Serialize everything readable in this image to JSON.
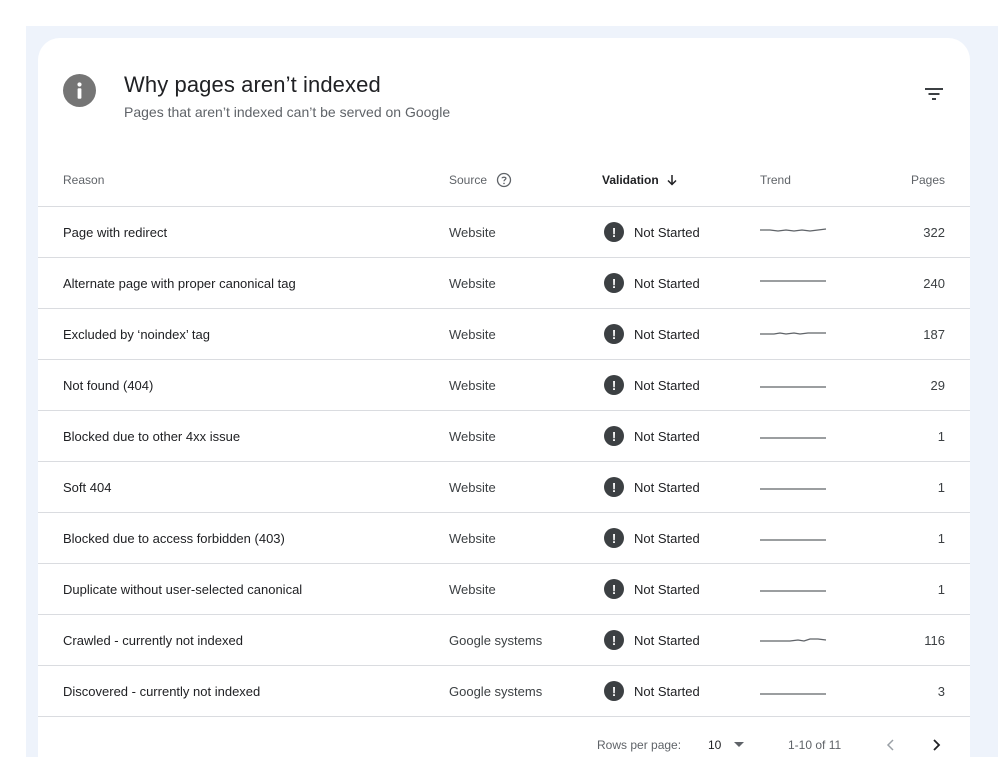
{
  "header": {
    "title": "Why pages aren’t indexed",
    "subtitle": "Pages that aren’t indexed can’t be served on Google"
  },
  "table": {
    "columns": {
      "reason": "Reason",
      "source": "Source",
      "validation": "Validation",
      "trend": "Trend",
      "pages": "Pages"
    },
    "rows": [
      {
        "reason": "Page with redirect",
        "source": "Website",
        "validation": "Not Started",
        "pages": "322"
      },
      {
        "reason": "Alternate page with proper canonical tag",
        "source": "Website",
        "validation": "Not Started",
        "pages": "240"
      },
      {
        "reason": "Excluded by ‘noindex’ tag",
        "source": "Website",
        "validation": "Not Started",
        "pages": "187"
      },
      {
        "reason": "Not found (404)",
        "source": "Website",
        "validation": "Not Started",
        "pages": "29"
      },
      {
        "reason": "Blocked due to other 4xx issue",
        "source": "Website",
        "validation": "Not Started",
        "pages": "1"
      },
      {
        "reason": "Soft 404",
        "source": "Website",
        "validation": "Not Started",
        "pages": "1"
      },
      {
        "reason": "Blocked due to access forbidden (403)",
        "source": "Website",
        "validation": "Not Started",
        "pages": "1"
      },
      {
        "reason": "Duplicate without user-selected canonical",
        "source": "Website",
        "validation": "Not Started",
        "pages": "1"
      },
      {
        "reason": "Crawled - currently not indexed",
        "source": "Google systems",
        "validation": "Not Started",
        "pages": "116"
      },
      {
        "reason": "Discovered - currently not indexed",
        "source": "Google systems",
        "validation": "Not Started",
        "pages": "3"
      }
    ]
  },
  "pagination": {
    "rows_per_page_label": "Rows per page:",
    "rows_per_page_value": "10",
    "range_label": "1-10 of 11"
  },
  "icons": {
    "header": "info-icon",
    "filter": "filter-icon",
    "source_help": "help-circle-icon",
    "sort": "arrow-down-icon",
    "status": "exclamation-icon",
    "rows_dropdown": "caret-down-icon",
    "prev": "chevron-left-icon",
    "next": "chevron-right-icon"
  },
  "colors": {
    "background_band": "#eef3fb",
    "status_icon": "#3c4043",
    "info_badge": "#757575",
    "divider": "#dadce0"
  }
}
